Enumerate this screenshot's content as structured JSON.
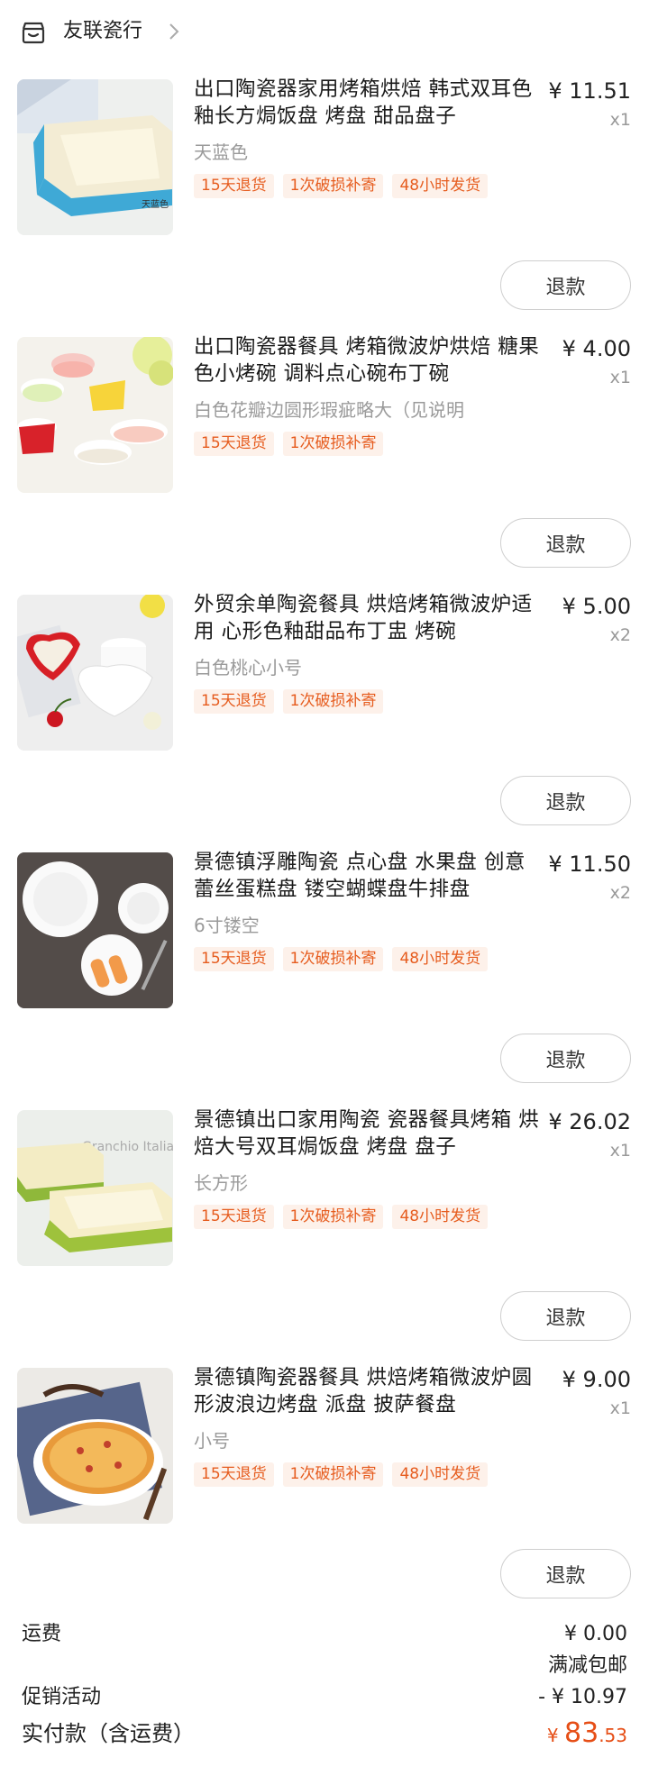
{
  "shop": {
    "name": "友联瓷行",
    "icon": "shop-icon",
    "chevron": "chevron-right-icon"
  },
  "items": [
    {
      "title": "出口陶瓷器家用烤箱烘焙 韩式双耳色釉长方焗饭盘  烤盘 甜品盘子",
      "sku": "天蓝色",
      "price": "¥ 11.51",
      "qty": "x1",
      "tags": [
        "15天退货",
        "1次破损补寄",
        "48小时发货"
      ],
      "refund": "退款",
      "thumb_caption": "天蓝色"
    },
    {
      "title": "出口陶瓷器餐具 烤箱微波炉烘焙 糖果色小烤碗 调料点心碗布丁碗",
      "sku": "白色花瓣边圆形瑕疵略大（见说明",
      "price": "¥ 4.00",
      "qty": "x1",
      "tags": [
        "15天退货",
        "1次破损补寄"
      ],
      "refund": "退款"
    },
    {
      "title": "外贸余单陶瓷餐具 烘焙烤箱微波炉适用 心形色釉甜品布丁盅 烤碗",
      "sku": "白色桃心小号",
      "price": "¥ 5.00",
      "qty": "x2",
      "tags": [
        "15天退货",
        "1次破损补寄"
      ],
      "refund": "退款"
    },
    {
      "title": "景德镇浮雕陶瓷 点心盘 水果盘 创意蕾丝蛋糕盘 镂空蝴蝶盘牛排盘",
      "sku": "6寸镂空",
      "price": "¥ 11.50",
      "qty": "x2",
      "tags": [
        "15天退货",
        "1次破损补寄",
        "48小时发货"
      ],
      "refund": "退款"
    },
    {
      "title": "景德镇出口家用陶瓷 瓷器餐具烤箱 烘焙大号双耳焗饭盘 烤盘 盘子",
      "sku": "长方形",
      "price": "¥ 26.02",
      "qty": "x1",
      "tags": [
        "15天退货",
        "1次破损补寄",
        "48小时发货"
      ],
      "refund": "退款",
      "thumb_caption": "Granchio Italia"
    },
    {
      "title": "景德镇陶瓷器餐具 烘焙烤箱微波炉圆形波浪边烤盘 派盘 披萨餐盘",
      "sku": "小号",
      "price": "¥ 9.00",
      "qty": "x1",
      "tags": [
        "15天退货",
        "1次破损补寄",
        "48小时发货"
      ],
      "refund": "退款"
    }
  ],
  "summary": {
    "shipping_label": "运费",
    "shipping_value": "¥ 0.00",
    "shipping_note": "满减包邮",
    "promo_label": "促销活动",
    "promo_value": "- ¥ 10.97",
    "paid_label": "实付款（含运费）",
    "paid_currency": "¥ ",
    "paid_int": "83",
    "paid_dec": ".53"
  },
  "colors": {
    "accent": "#e64e16",
    "tag_bg": "#fdf1ea",
    "muted": "#999999"
  }
}
